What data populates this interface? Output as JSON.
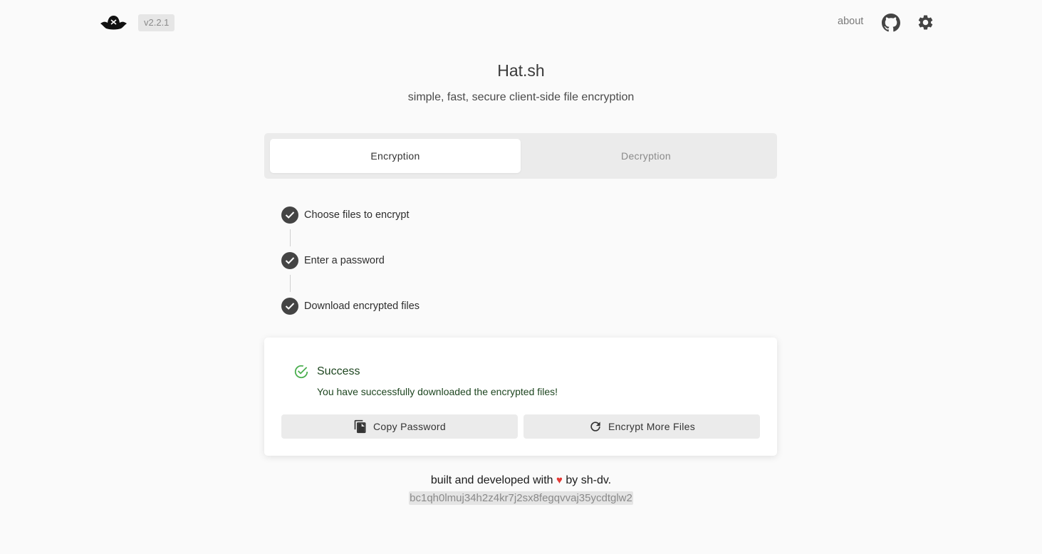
{
  "header": {
    "version": "v2.2.1",
    "about_label": "about",
    "github_icon": "github-icon",
    "settings_icon": "gear-icon",
    "logo_icon": "pirate-hat-icon"
  },
  "hero": {
    "title": "Hat.sh",
    "subtitle": "simple, fast, secure client-side file encryption"
  },
  "tabs": [
    {
      "label": "Encryption",
      "active": true
    },
    {
      "label": "Decryption",
      "active": false
    }
  ],
  "steps": [
    {
      "label": "Choose files to encrypt",
      "completed": true
    },
    {
      "label": "Enter a password",
      "completed": true
    },
    {
      "label": "Download encrypted files",
      "completed": true
    }
  ],
  "result": {
    "title": "Success",
    "message": "You have successfully downloaded the encrypted files!",
    "copy_button": "Copy Password",
    "more_button": "Encrypt More Files"
  },
  "footer": {
    "line_before": "built and developed with",
    "line_after": "by sh-dv.",
    "heart": "♥",
    "btc_address": "bc1qh0lmuj34h2z4kr7j2sx8fegqvvaj35ycdtglw2"
  },
  "colors": {
    "background": "#fafafa",
    "success_green": "#4caf50",
    "heart_red": "#e53935"
  }
}
